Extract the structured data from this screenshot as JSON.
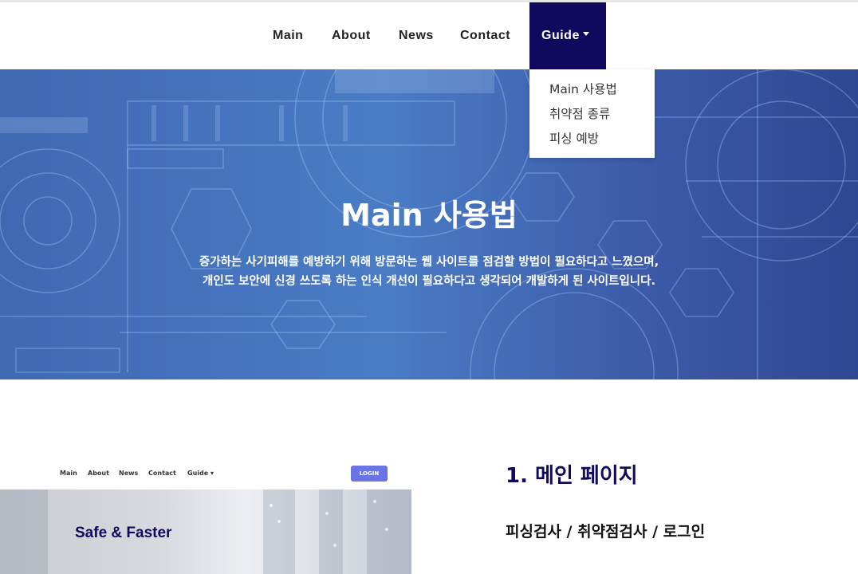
{
  "nav": {
    "items": [
      "Main",
      "About",
      "News",
      "Contact"
    ],
    "guide_label": "Guide",
    "dropdown": [
      "Main 사용법",
      "취약점 종류",
      "피싱 예방"
    ]
  },
  "hero": {
    "title": "Main 사용법",
    "desc_line1": "증가하는 사기피해를 예방하기 위해 방문하는 웹 사이트를 점검할 방법이 필요하다고 느꼈으며,",
    "desc_line2": "개인도 보안에 신경 쓰도록 하는 인식 개선이 필요하다고 생각되어 개발하게 된 사이트입니다."
  },
  "preview": {
    "nav_items": [
      "Main",
      "About",
      "News",
      "Contact",
      "Guide"
    ],
    "login_label": "LOGIN",
    "headline": "Safe & Faster"
  },
  "section": {
    "title": "1. 메인 페이지",
    "subtitle": "피싱검사 / 취약점검사 / 로그인"
  }
}
